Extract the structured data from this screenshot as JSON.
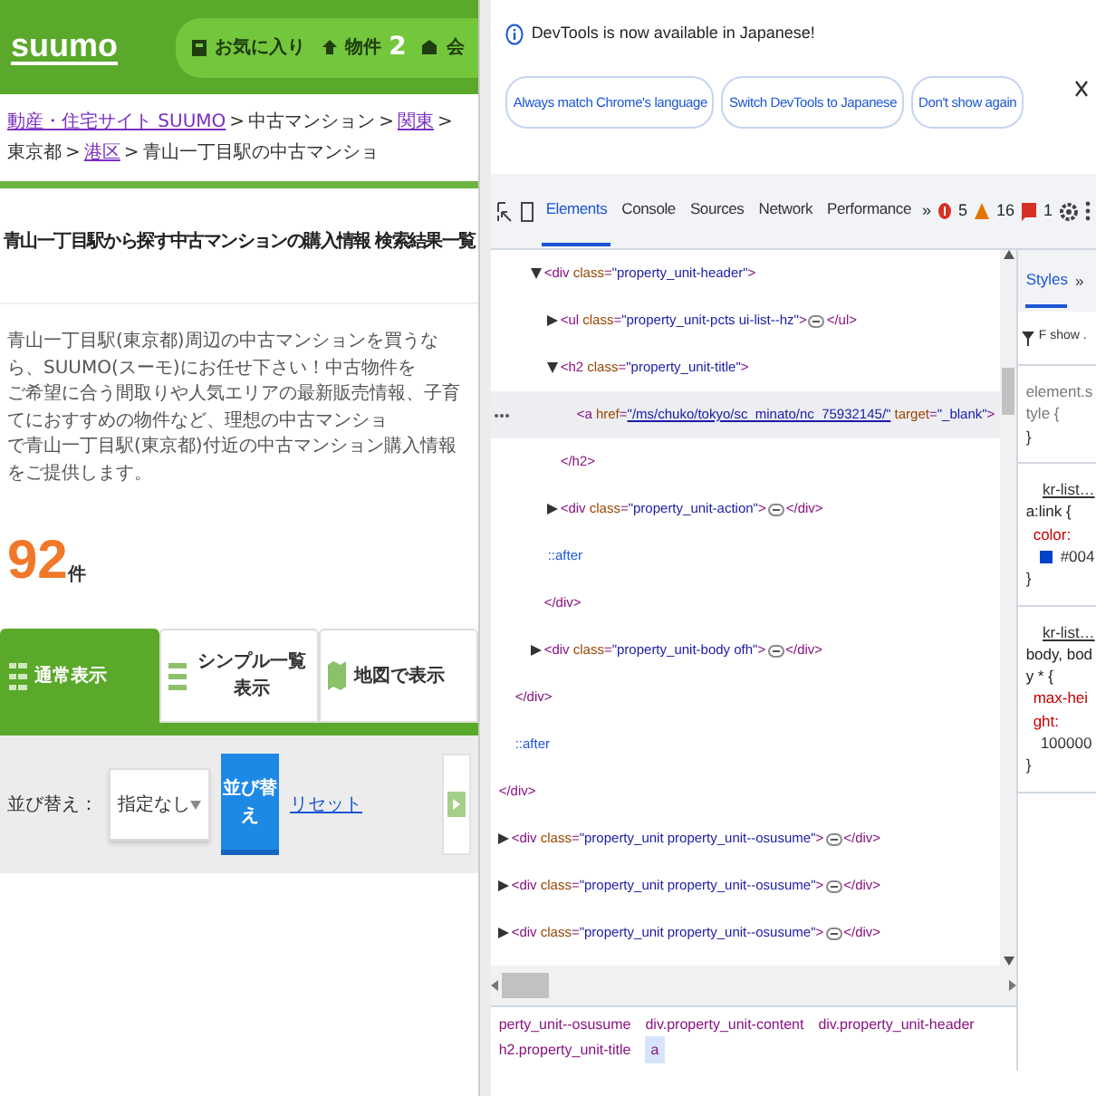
{
  "page": {
    "logo": "suumo",
    "header_links": [
      {
        "kind": "favorite",
        "label": "お気に入り"
      },
      {
        "kind": "count",
        "label": "物件",
        "count": "2"
      },
      {
        "kind": "member",
        "label": "会"
      }
    ],
    "breadcrumb": [
      {
        "kind": "link",
        "label": "動産・住宅サイト SUUMO",
        "visited": true
      },
      {
        "kind": "link",
        "sep": ">",
        "label": "中古マンション",
        "visited": false
      },
      {
        "kind": "link",
        "sep": ">",
        "label": "関東",
        "visited": true
      },
      {
        "kind": "link",
        "sep": ">",
        "label": "東京都",
        "visited": false
      },
      {
        "kind": "link",
        "sep": ">",
        "label": "港区",
        "visited": true
      },
      {
        "kind": "current",
        "sep": ">",
        "label": "青山一丁目駅の中古マンショ"
      }
    ],
    "title": "青山一丁目駅から探す中古マンションの購入情報 検索結果一覧",
    "description": [
      "青山一丁目駅(東京都)周辺の中古マンションを買うなら、SUUMO(スーモ)にお任せ下さい！中古物件を",
      "ご希望に合う間取りや人気エリアの最新販売情報、子育てにおすすめの物件など、理想の中古マンショ",
      "で青山一丁目駅(東京都)付近の中古マンション購入情報をご提供します。"
    ],
    "count": {
      "number": "92",
      "unit": "件"
    },
    "view_tabs": [
      {
        "label": "通常表示",
        "kind": "list",
        "selected": true
      },
      {
        "label": "シンプル一覧表示",
        "kind": "simple",
        "selected": false
      },
      {
        "label": "地図で表示",
        "kind": "map",
        "selected": false
      }
    ],
    "sort": {
      "label": "並び替え：",
      "select": "指定なし",
      "button": "並び替え",
      "reset": "リセット"
    }
  },
  "devtools": {
    "notice": {
      "text": "DevTools is now available in Japanese!",
      "buttons": [
        "Always match Chrome's language",
        "Switch DevTools to Japanese",
        "Don't show again"
      ]
    },
    "tabs": [
      {
        "label": "Elements",
        "selected": true
      },
      {
        "label": "Console",
        "selected": false
      },
      {
        "label": "Sources",
        "selected": false
      },
      {
        "label": "Network",
        "selected": false
      },
      {
        "label": "Performance",
        "selected": false
      }
    ],
    "more": "»",
    "errors": "5",
    "warnings": "16",
    "issues": "1",
    "tree": [
      {
        "kind": "partial",
        "close": "</div>",
        "children": [
          {
            "kind": "partial",
            "close": "</div>",
            "children": [
              {
                "kind": "element",
                "open": "<div class=\"property_unit-header\">",
                "expanded": true,
                "selected": false,
                "close": "</div>",
                "children": [
                  {
                    "kind": "element",
                    "open": "<ul class=\"property_unit-pcts ui-list--hz\">",
                    "expanded": false,
                    "selected": false,
                    "close": "</ul>"
                  },
                  {
                    "kind": "element",
                    "open": "<h2 class=\"property_unit-title\">",
                    "expanded": true,
                    "selected": false,
                    "close": "</h2>",
                    "children": [
                      {
                        "kind": "element",
                        "open": "<a href=\"/ms/chuko/tokyo/sc_minato/nc_75932145/\" target=\"_blank\">",
                        "selected": true
                      }
                    ]
                  },
                  {
                    "kind": "element",
                    "open": "<div class=\"property_unit-action\">",
                    "expanded": false,
                    "selected": false,
                    "close": "</div>"
                  },
                  {
                    "kind": "pseudo",
                    "text": "::after"
                  }
                ]
              },
              {
                "kind": "element",
                "open": "<div class=\"property_unit-body ofh\">",
                "expanded": false,
                "selected": false,
                "close": "</div>"
              }
            ]
          },
          {
            "kind": "pseudo",
            "text": "::after"
          }
        ]
      },
      {
        "kind": "element",
        "open": "<div class=\"property_unit property_unit--osusume\">",
        "expanded": false,
        "selected": false,
        "close": "</div>"
      },
      {
        "kind": "element",
        "open": "<div class=\"property_unit property_unit--osusume\">",
        "expanded": false,
        "selected": false,
        "close": "</div>"
      },
      {
        "kind": "element",
        "open": "<div class=\"property_unit property_unit--osusume\">",
        "expanded": false,
        "selected": false,
        "close": "</div>"
      }
    ],
    "styles": {
      "tab": "Styles",
      "more": "»",
      "filter": "F",
      "filter_hint": "show .",
      "rules": [
        {
          "selector": "element.style",
          "open": "{",
          "close": "}"
        },
        {
          "source": "kr-list…",
          "selector": "a:link",
          "open": "{",
          "props": [
            {
              "name": "color",
              "sep": ":",
              "value": "#004",
              "color": "#0044cc"
            }
          ],
          "close": "}"
        },
        {
          "source": "kr-list…",
          "selector": "body, body *",
          "open": "{",
          "props": [
            {
              "name": "max-height",
              "sep": ":",
              "value": "100000"
            }
          ],
          "close": "}"
        }
      ]
    },
    "crumbs": [
      {
        "label": "perty_unit--osusume",
        "selected": false
      },
      {
        "label": "div.property_unit-content",
        "selected": false
      },
      {
        "label": "div.property_unit-header",
        "selected": false
      },
      {
        "label": "h2.property_unit-title",
        "selected": false
      },
      {
        "label": "a",
        "selected": true
      }
    ]
  }
}
